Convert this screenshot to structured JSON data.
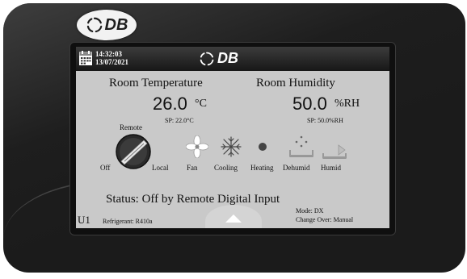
{
  "brand": {
    "logo_text": "DB",
    "logo_icon": "db-swirl-icon"
  },
  "header": {
    "time": "14:32:03",
    "date": "13/07/2021",
    "logo_text": "DB",
    "calendar_icon": "calendar-icon"
  },
  "temperature": {
    "label": "Room Temperature",
    "value": "26.0",
    "unit": "°C",
    "setpoint": "SP:  22.0°C"
  },
  "humidity": {
    "label": "Room Humidity",
    "value": "50.0",
    "unit": "%RH",
    "setpoint": "SP:  50.0%RH"
  },
  "control": {
    "remote_label": "Remote",
    "off_label": "Off",
    "local_label": "Local"
  },
  "modes": [
    {
      "label": "Fan",
      "icon": "fan-icon"
    },
    {
      "label": "Cooling",
      "icon": "snowflake-icon"
    },
    {
      "label": "Heating",
      "icon": "heating-dot-icon"
    },
    {
      "label": "Dehumid",
      "icon": "dehumidifier-icon"
    },
    {
      "label": "Humid",
      "icon": "humidifier-icon"
    }
  ],
  "status": {
    "text": "Status: Off by Remote Digital Input"
  },
  "footer": {
    "unit": "U1",
    "refrigerant": "Refrigerant: R410a",
    "mode": "Mode: DX",
    "changeover": "Change Over: Manual"
  },
  "colors": {
    "bezel": "#1b1b1b",
    "screen": "#c9c9c9",
    "topbar": "#232323",
    "text": "#111111"
  }
}
